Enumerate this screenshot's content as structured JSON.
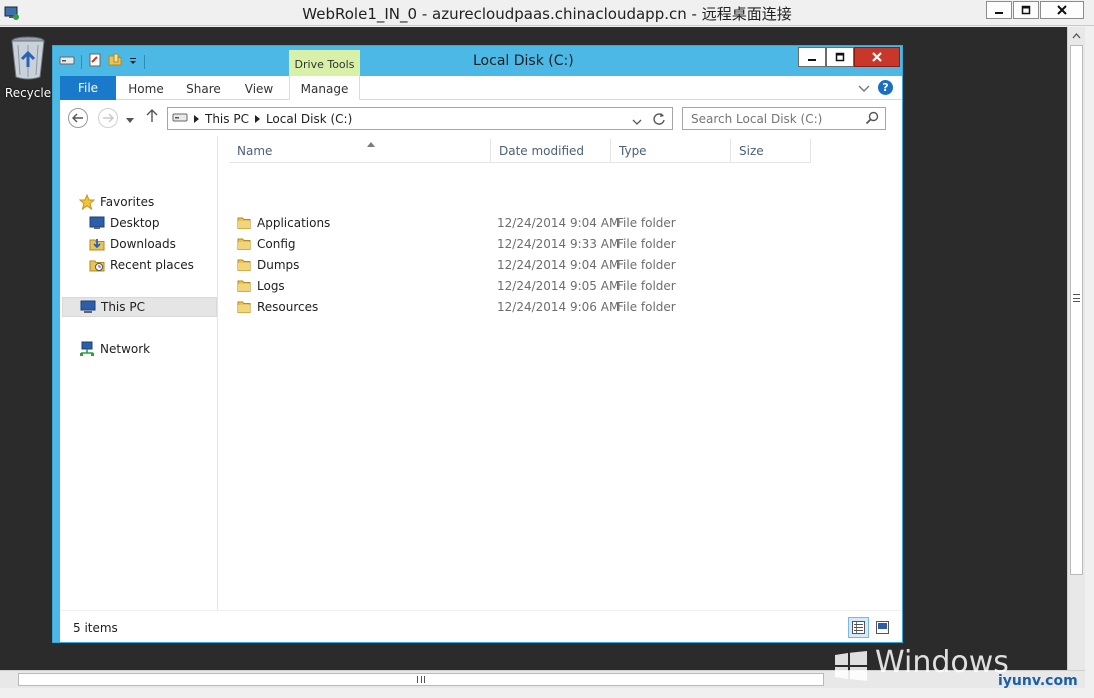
{
  "rdp": {
    "title": "WebRole1_IN_0 - azurecloudpaas.chinacloudapp.cn - 远程桌面连接"
  },
  "desktop": {
    "recycle_label": "Recycle"
  },
  "explorer": {
    "title": "Local Disk (C:)",
    "contextual_tab_group": "Drive Tools",
    "ribbon_tabs": [
      "File",
      "Home",
      "Share",
      "View",
      "Manage"
    ],
    "address": {
      "crumbs": [
        "This PC",
        "Local Disk (C:)"
      ]
    },
    "search": {
      "placeholder": "Search Local Disk (C:)"
    },
    "nav": {
      "favorites": "Favorites",
      "desktop": "Desktop",
      "downloads": "Downloads",
      "recent_places": "Recent places",
      "this_pc": "This PC",
      "network": "Network"
    },
    "columns": [
      "Name",
      "Date modified",
      "Type",
      "Size"
    ],
    "files": [
      {
        "name": "Applications",
        "date": "12/24/2014 9:04 AM",
        "type": "File folder"
      },
      {
        "name": "Config",
        "date": "12/24/2014 9:33 AM",
        "type": "File folder"
      },
      {
        "name": "Dumps",
        "date": "12/24/2014 9:04 AM",
        "type": "File folder"
      },
      {
        "name": "Logs",
        "date": "12/24/2014 9:05 AM",
        "type": "File folder"
      },
      {
        "name": "Resources",
        "date": "12/24/2014 9:06 AM",
        "type": "File folder"
      }
    ],
    "status": "5 items"
  },
  "watermark": {
    "text": "Windows",
    "site": "iyunv.com"
  },
  "colors": {
    "window_frame": "#4cb8e6",
    "file_tab": "#1979ca",
    "drive_tools": "#d8f0a8",
    "close_button": "#c7372a",
    "folder": "#e8c35a"
  }
}
